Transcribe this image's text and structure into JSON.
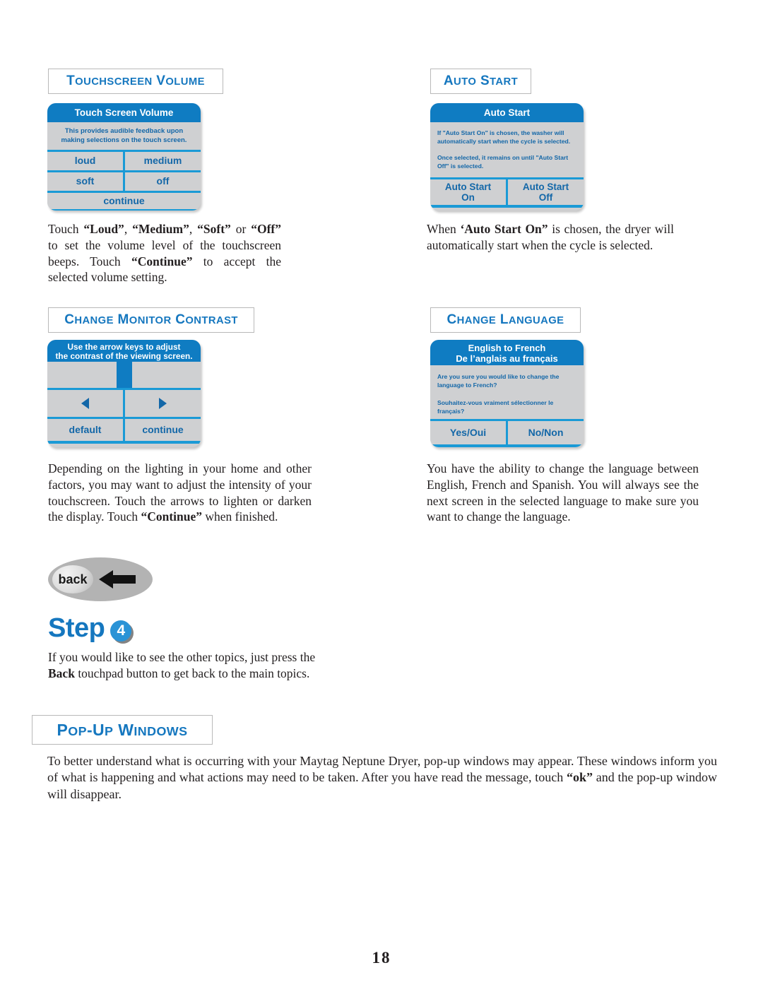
{
  "page": {
    "number": "18",
    "accent_blue": "#1577bf",
    "panel_blue": "#0f7cc2",
    "panel_gray": "#cfd0d2",
    "divider_blue": "#1a9ad6",
    "panel_text_blue": "#1367a8"
  },
  "sections": {
    "touchscreen_volume": {
      "heading": "TOUCHSCREEN VOLUME",
      "panel": {
        "title": "Touch Screen Volume",
        "description": "This provides audible feedback upon\nmaking selections on the touch screen.",
        "buttons_row1": [
          "loud",
          "medium"
        ],
        "buttons_row2": [
          "soft",
          "off"
        ],
        "buttons_row3": [
          "continue"
        ]
      },
      "body": [
        {
          "t": "Touch ",
          "b": false
        },
        {
          "t": "“Loud”",
          "b": true
        },
        {
          "t": ", ",
          "b": false
        },
        {
          "t": "“Medium”",
          "b": true
        },
        {
          "t": ", ",
          "b": false
        },
        {
          "t": "“Soft”",
          "b": true
        },
        {
          "t": " or ",
          "b": false
        },
        {
          "t": "“Off”",
          "b": true
        },
        {
          "t": " to set the volume level of the touchscreen beeps. Touch ",
          "b": false
        },
        {
          "t": "“Continue”",
          "b": true
        },
        {
          "t": " to accept the selected volume setting.",
          "b": false
        }
      ]
    },
    "auto_start": {
      "heading": "AUTO START",
      "panel": {
        "title": "Auto Start",
        "description_p1": "If \"Auto Start On\" is chosen, the washer will automatically start when the cycle is selected.",
        "description_p2": "Once selected, it remains on until \"Auto Start Off\" is selected.",
        "buttons": [
          "Auto Start\nOn",
          "Auto Start\nOff"
        ]
      },
      "body": [
        {
          "t": "When ",
          "b": false
        },
        {
          "t": "‘Auto Start On”",
          "b": true
        },
        {
          "t": " is chosen, the dryer will automatically start when the cycle is selected.",
          "b": false
        }
      ]
    },
    "change_monitor_contrast": {
      "heading": "CHANGE MONITOR CONTRAST",
      "panel": {
        "title": "Use the arrow keys to adjust\nthe contrast of the viewing screen.",
        "arrow_left_icon": "arrow-left-icon",
        "arrow_right_icon": "arrow-right-icon",
        "buttons": [
          "default",
          "continue"
        ]
      },
      "body": [
        {
          "t": "Depending on the lighting in your home and other factors, you may want to adjust the intensity of your touchscreen. Touch the arrows to lighten or darken the display. Touch ",
          "b": false
        },
        {
          "t": "“Continue”",
          "b": true
        },
        {
          "t": " when finished.",
          "b": false
        }
      ]
    },
    "change_language": {
      "heading": "CHANGE LANGUAGE",
      "panel": {
        "title_line1": "English to French",
        "title_line2": "De l’anglais au français",
        "description_p1": "Are you sure you would like to change the language to French?",
        "description_p2": "Souhaitez-vous vraiment sélectionner le français?",
        "buttons": [
          "Yes/Oui",
          "No/Non"
        ]
      },
      "body": [
        {
          "t": "You have the ability to change the language between English, French and Spanish.  You will always see the next screen in the selected language to make sure you want to change the language.",
          "b": false
        }
      ]
    },
    "back_button": {
      "label": "back",
      "icon": "arrow-left-icon"
    },
    "step": {
      "word": "Step",
      "number": "4",
      "body": [
        {
          "t": "If you would like to see the other topics, just press the ",
          "b": false
        },
        {
          "t": "Back",
          "b": true
        },
        {
          "t": " touchpad button to get back to the main topics.",
          "b": false
        }
      ]
    },
    "popup_windows": {
      "heading": "POP-UP WINDOWS",
      "body": [
        {
          "t": "To better understand what is occurring with your Maytag Neptune Dryer, pop-up windows may appear.  These windows inform you of what is happening and what actions may need to be taken.  After you have read the message, touch ",
          "b": false
        },
        {
          "t": "“ok”",
          "b": true
        },
        {
          "t": " and the pop-up window will disappear.",
          "b": false
        }
      ]
    }
  }
}
